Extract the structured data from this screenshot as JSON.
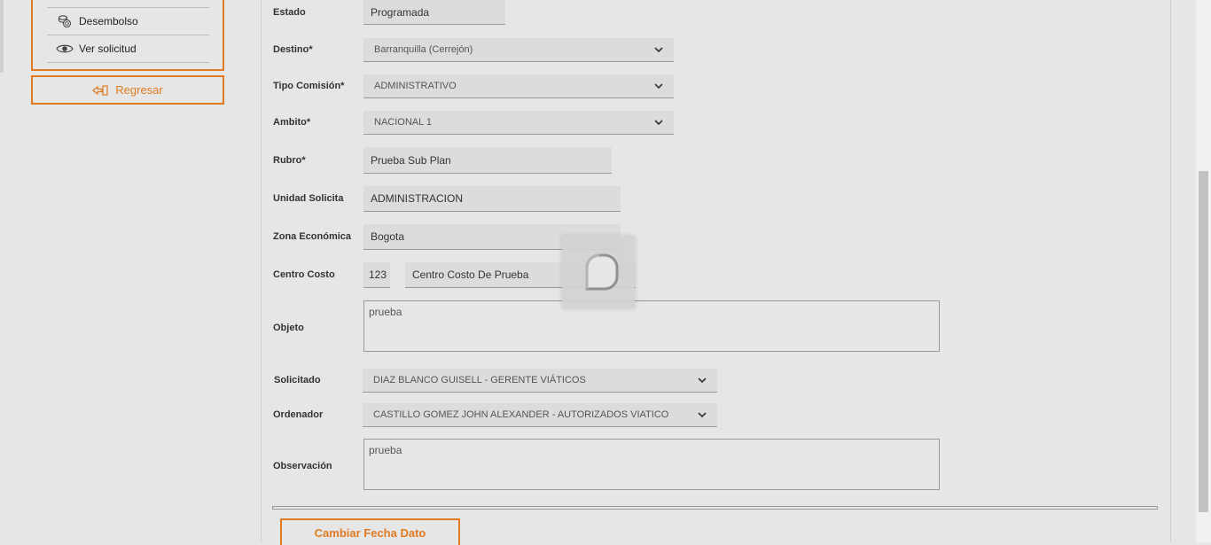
{
  "sidebar": {
    "items": [
      {
        "label": "Desembolso",
        "icon": "coins-icon"
      },
      {
        "label": "Ver solicitud",
        "icon": "eye-icon"
      }
    ],
    "back_label": "Regresar",
    "accent": "#e07b24"
  },
  "form": {
    "estado": {
      "label": "Estado",
      "value": "Programada"
    },
    "destino": {
      "label": "Destino*",
      "value": "Barranquilla (Cerrejón)"
    },
    "tipo_comision": {
      "label": "Tipo Comisión*",
      "value": "ADMINISTRATIVO"
    },
    "ambito": {
      "label": "Ambito*",
      "value": "NACIONAL 1"
    },
    "rubro": {
      "label": "Rubro*",
      "value": "Prueba Sub Plan"
    },
    "unidad_solicita": {
      "label": "Unidad Solicita",
      "value": "ADMINISTRACION"
    },
    "zona_economica": {
      "label": "Zona Económica",
      "value": "Bogota"
    },
    "centro_costo": {
      "label": "Centro Costo",
      "code": "123",
      "value": "Centro Costo De Prueba"
    },
    "objeto": {
      "label": "Objeto",
      "value": "prueba"
    },
    "solicitado": {
      "label": "Solicitado",
      "value": "DIAZ BLANCO GUISELL - GERENTE VIÁTICOS"
    },
    "ordenador": {
      "label": "Ordenador",
      "value": "CASTILLO GOMEZ JOHN ALEXANDER - AUTORIZADOS VIATICO"
    },
    "observacion": {
      "label": "Observación",
      "value": "prueba"
    }
  },
  "actions": {
    "change_date_label": "Cambiar Fecha Dato"
  }
}
